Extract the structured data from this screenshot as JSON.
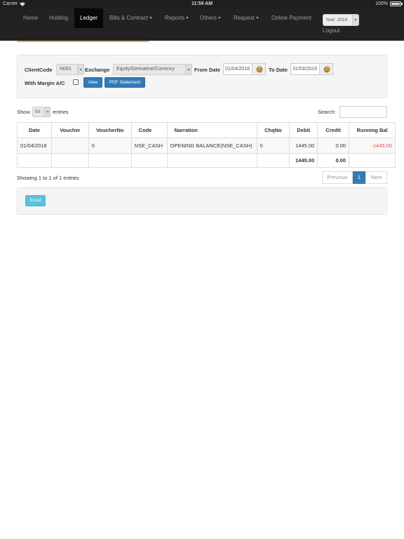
{
  "status_bar": {
    "carrier": "Carrier",
    "time": "11:59 AM",
    "battery": "100%",
    "battery_level": 1.0
  },
  "nav": {
    "items": [
      {
        "label": "Home",
        "caret": false,
        "active": false
      },
      {
        "label": "Holding",
        "caret": false,
        "active": false
      },
      {
        "label": "Ledger",
        "caret": false,
        "active": true
      },
      {
        "label": "Bills & Contract",
        "caret": true,
        "active": false
      },
      {
        "label": "Reports",
        "caret": true,
        "active": false
      },
      {
        "label": "Others",
        "caret": true,
        "active": false
      },
      {
        "label": "Request",
        "caret": true,
        "active": false
      },
      {
        "label": "Online Payment",
        "caret": false,
        "active": false
      }
    ],
    "year_select": "Year: 2018",
    "logout": "Logout"
  },
  "filters": {
    "client_code_label": "ClientCode",
    "client_code_value": "N061",
    "exchange_label": "Exchange",
    "exchange_value": "Equity/Derivative/Currency",
    "from_date_label": "From Date",
    "from_date_value": "01/04/2018",
    "to_date_label": "To Date",
    "to_date_value": "31/03/2019",
    "margin_label": "With Margin A/C",
    "margin_checked": false,
    "view_button": "View",
    "pdf_button": "PDF Statement"
  },
  "table_controls": {
    "show_label": "Show",
    "entries_value": "50",
    "entries_label": "entries",
    "search_label": "Search:",
    "search_value": ""
  },
  "table": {
    "headers": [
      "Date",
      "Voucher",
      "VoucherNo",
      "Code",
      "Narration",
      "ChqNo",
      "Debit",
      "Credit",
      "Running Bal"
    ],
    "rows": [
      {
        "date": "01/04/2018",
        "voucher": "",
        "voucher_no": "0",
        "code": "NSE_CASH",
        "narration": "OPENING BALANCE(NSE_CASH)",
        "chq_no": "0",
        "debit": "1445.00",
        "credit": "0.00",
        "running_bal": "-1445.00"
      }
    ],
    "totals": {
      "debit": "1445.00",
      "credit": "0.00"
    }
  },
  "pagination": {
    "info": "Showing 1 to 1 of 1 entries",
    "previous": "Previous",
    "current_page": "1",
    "next": "Next"
  },
  "export": {
    "excel_button": "Excel"
  },
  "colors": {
    "navbar": "#222222",
    "active_nav": "#080808",
    "primary": "#337ab7",
    "info": "#5bc0de",
    "negative": "#d9534f",
    "accent_bar": "#e0b44a"
  }
}
